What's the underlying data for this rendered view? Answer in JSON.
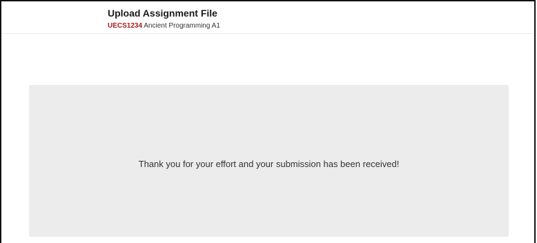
{
  "header": {
    "title": "Upload Assignment File",
    "course_code": "UECS1234",
    "course_name": "Ancient Programming A1"
  },
  "notice": {
    "message": "Thank you for your effort and your submission has been received!"
  }
}
